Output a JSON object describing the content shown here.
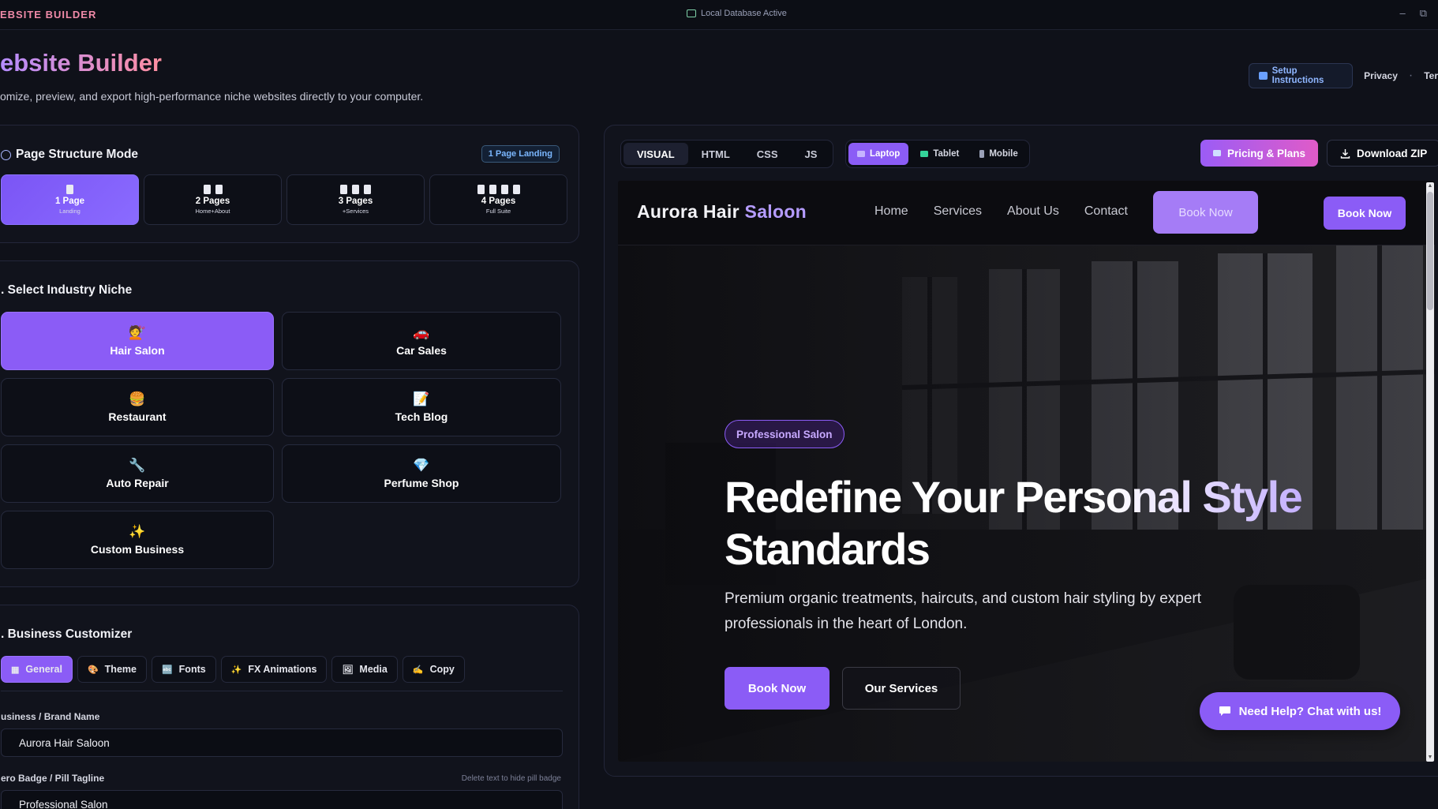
{
  "window": {
    "app_name": "EBSITE BUILDER",
    "db_status": "Local Database Active",
    "minimize": "–",
    "restore": "⧉"
  },
  "header": {
    "title": "ebsite Builder",
    "subtitle": "omize, preview, and export high-performance niche websites directly to your computer.",
    "setup_label": "Setup Instructions",
    "privacy_label": "Privacy",
    "terms_label": "Ter",
    "separator": "·"
  },
  "structure": {
    "title": "Page Structure Mode",
    "badge": "1 Page Landing",
    "modes": [
      {
        "label": "1 Page",
        "sub": "Landing",
        "docs": 1,
        "active": true
      },
      {
        "label": "2 Pages",
        "sub": "Home+About",
        "docs": 2,
        "active": false
      },
      {
        "label": "3 Pages",
        "sub": "+Services",
        "docs": 3,
        "active": false
      },
      {
        "label": "4 Pages",
        "sub": "Full Suite",
        "docs": 4,
        "active": false
      }
    ]
  },
  "niche": {
    "title": ". Select Industry Niche",
    "items": [
      {
        "label": "Hair Salon",
        "emoji": "💇",
        "icon": "hair-salon-icon",
        "active": true
      },
      {
        "label": "Car Sales",
        "emoji": "🚗",
        "icon": "car-icon",
        "active": false
      },
      {
        "label": "Restaurant",
        "emoji": "🍔",
        "icon": "burger-icon",
        "active": false
      },
      {
        "label": "Tech Blog",
        "emoji": "📝",
        "icon": "memo-icon",
        "active": false
      },
      {
        "label": "Auto Repair",
        "emoji": "🔧",
        "icon": "wrench-icon",
        "active": false
      },
      {
        "label": "Perfume Shop",
        "emoji": "💎",
        "icon": "gem-icon",
        "active": false
      },
      {
        "label": "Custom Business",
        "emoji": "✨",
        "icon": "sparkles-icon",
        "active": false
      }
    ]
  },
  "customizer": {
    "title": ". Business Customizer",
    "tabs": [
      {
        "label": "General",
        "emoji": "▦",
        "active": true
      },
      {
        "label": "Theme",
        "emoji": "🎨",
        "active": false
      },
      {
        "label": "Fonts",
        "emoji": "🔤",
        "active": false
      },
      {
        "label": "FX Animations",
        "emoji": "✨",
        "active": false
      },
      {
        "label": "Media",
        "emoji": "🖼",
        "active": false
      },
      {
        "label": "Copy",
        "emoji": "✍",
        "active": false
      }
    ],
    "brand_label": "usiness / Brand Name",
    "brand_value": "Aurora Hair Saloon",
    "badge_label": "ero Badge / Pill Tagline",
    "badge_hint": "Delete text to hide pill badge",
    "badge_value": "Professional Salon"
  },
  "preview": {
    "code_tabs": [
      "VISUAL",
      "HTML",
      "CSS",
      "JS"
    ],
    "active_code_tab": "VISUAL",
    "devices": [
      {
        "label": "Laptop",
        "color": "#c6b4ff",
        "active": true
      },
      {
        "label": "Tablet",
        "color": "#34d399",
        "active": false
      },
      {
        "label": "Mobile",
        "color": "#9aa0b8",
        "active": false
      }
    ],
    "pricing_label": "Pricing & Plans",
    "download_label": "Download ZIP"
  },
  "site": {
    "logo_main": "Aurora Hair",
    "logo_accent": "Saloon",
    "nav": [
      "Home",
      "Services",
      "About Us",
      "Contact"
    ],
    "nav_cta_ghost": "Book Now",
    "nav_cta": "Book Now",
    "pill": "Professional Salon",
    "headline_main": "Redefine Your Pers",
    "headline_accent": "onal Style",
    "headline_line2": "Standards",
    "description": "Premium organic treatments, haircuts, and custom hair styling by expert professionals in the heart of London.",
    "primary_btn": "Book Now",
    "secondary_btn": "Our Services",
    "chat_label": "Need Help? Chat with us!"
  },
  "colors": {
    "accent": "#8b5cf6",
    "background": "#0f1119",
    "panel": "#11131c"
  }
}
